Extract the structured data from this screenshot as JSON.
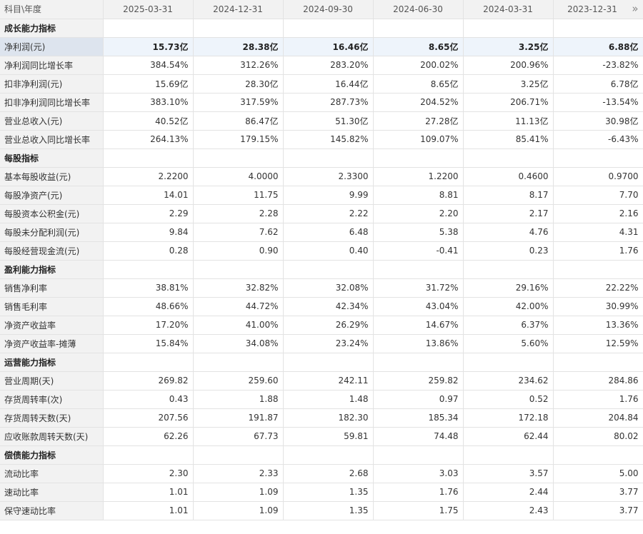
{
  "header": {
    "corner": "科目\\年度",
    "periods": [
      "2025-03-31",
      "2024-12-31",
      "2024-09-30",
      "2024-06-30",
      "2024-03-31",
      "2023-12-31"
    ],
    "more_icon": "double-chevron-right-icon"
  },
  "colors": {
    "header_bg": "#f2f2f2",
    "highlight_row_bg": "#eef4fb",
    "highlight_label_bg": "#dde4ee",
    "border": "#e3e3e3"
  },
  "rows": [
    {
      "type": "section",
      "label": "成长能力指标"
    },
    {
      "type": "data",
      "highlight": true,
      "label": "净利润(元)",
      "values": [
        "15.73亿",
        "28.38亿",
        "16.46亿",
        "8.65亿",
        "3.25亿",
        "6.88亿"
      ]
    },
    {
      "type": "data",
      "label": "净利润同比增长率",
      "values": [
        "384.54%",
        "312.26%",
        "283.20%",
        "200.02%",
        "200.96%",
        "-23.82%"
      ]
    },
    {
      "type": "data",
      "label": "扣非净利润(元)",
      "values": [
        "15.69亿",
        "28.30亿",
        "16.44亿",
        "8.65亿",
        "3.25亿",
        "6.78亿"
      ]
    },
    {
      "type": "data",
      "label": "扣非净利润同比增长率",
      "values": [
        "383.10%",
        "317.59%",
        "287.73%",
        "204.52%",
        "206.71%",
        "-13.54%"
      ]
    },
    {
      "type": "data",
      "label": "营业总收入(元)",
      "values": [
        "40.52亿",
        "86.47亿",
        "51.30亿",
        "27.28亿",
        "11.13亿",
        "30.98亿"
      ]
    },
    {
      "type": "data",
      "label": "营业总收入同比增长率",
      "values": [
        "264.13%",
        "179.15%",
        "145.82%",
        "109.07%",
        "85.41%",
        "-6.43%"
      ]
    },
    {
      "type": "section",
      "label": "每股指标"
    },
    {
      "type": "data",
      "label": "基本每股收益(元)",
      "values": [
        "2.2200",
        "4.0000",
        "2.3300",
        "1.2200",
        "0.4600",
        "0.9700"
      ]
    },
    {
      "type": "data",
      "label": "每股净资产(元)",
      "values": [
        "14.01",
        "11.75",
        "9.99",
        "8.81",
        "8.17",
        "7.70"
      ]
    },
    {
      "type": "data",
      "label": "每股资本公积金(元)",
      "values": [
        "2.29",
        "2.28",
        "2.22",
        "2.20",
        "2.17",
        "2.16"
      ]
    },
    {
      "type": "data",
      "label": "每股未分配利润(元)",
      "values": [
        "9.84",
        "7.62",
        "6.48",
        "5.38",
        "4.76",
        "4.31"
      ]
    },
    {
      "type": "data",
      "label": "每股经营现金流(元)",
      "values": [
        "0.28",
        "0.90",
        "0.40",
        "-0.41",
        "0.23",
        "1.76"
      ]
    },
    {
      "type": "section",
      "label": "盈利能力指标"
    },
    {
      "type": "data",
      "label": "销售净利率",
      "values": [
        "38.81%",
        "32.82%",
        "32.08%",
        "31.72%",
        "29.16%",
        "22.22%"
      ]
    },
    {
      "type": "data",
      "label": "销售毛利率",
      "values": [
        "48.66%",
        "44.72%",
        "42.34%",
        "43.04%",
        "42.00%",
        "30.99%"
      ]
    },
    {
      "type": "data",
      "label": "净资产收益率",
      "values": [
        "17.20%",
        "41.00%",
        "26.29%",
        "14.67%",
        "6.37%",
        "13.36%"
      ]
    },
    {
      "type": "data",
      "label": "净资产收益率-摊薄",
      "values": [
        "15.84%",
        "34.08%",
        "23.24%",
        "13.86%",
        "5.60%",
        "12.59%"
      ]
    },
    {
      "type": "section",
      "label": "运营能力指标"
    },
    {
      "type": "data",
      "label": "营业周期(天)",
      "values": [
        "269.82",
        "259.60",
        "242.11",
        "259.82",
        "234.62",
        "284.86"
      ]
    },
    {
      "type": "data",
      "label": "存货周转率(次)",
      "values": [
        "0.43",
        "1.88",
        "1.48",
        "0.97",
        "0.52",
        "1.76"
      ]
    },
    {
      "type": "data",
      "label": "存货周转天数(天)",
      "values": [
        "207.56",
        "191.87",
        "182.30",
        "185.34",
        "172.18",
        "204.84"
      ]
    },
    {
      "type": "data",
      "label": "应收账款周转天数(天)",
      "values": [
        "62.26",
        "67.73",
        "59.81",
        "74.48",
        "62.44",
        "80.02"
      ]
    },
    {
      "type": "section",
      "label": "偿债能力指标"
    },
    {
      "type": "data",
      "label": "流动比率",
      "values": [
        "2.30",
        "2.33",
        "2.68",
        "3.03",
        "3.57",
        "5.00"
      ]
    },
    {
      "type": "data",
      "label": "速动比率",
      "values": [
        "1.01",
        "1.09",
        "1.35",
        "1.76",
        "2.44",
        "3.77"
      ]
    },
    {
      "type": "data",
      "label": "保守速动比率",
      "values": [
        "1.01",
        "1.09",
        "1.35",
        "1.75",
        "2.43",
        "3.77"
      ]
    }
  ]
}
